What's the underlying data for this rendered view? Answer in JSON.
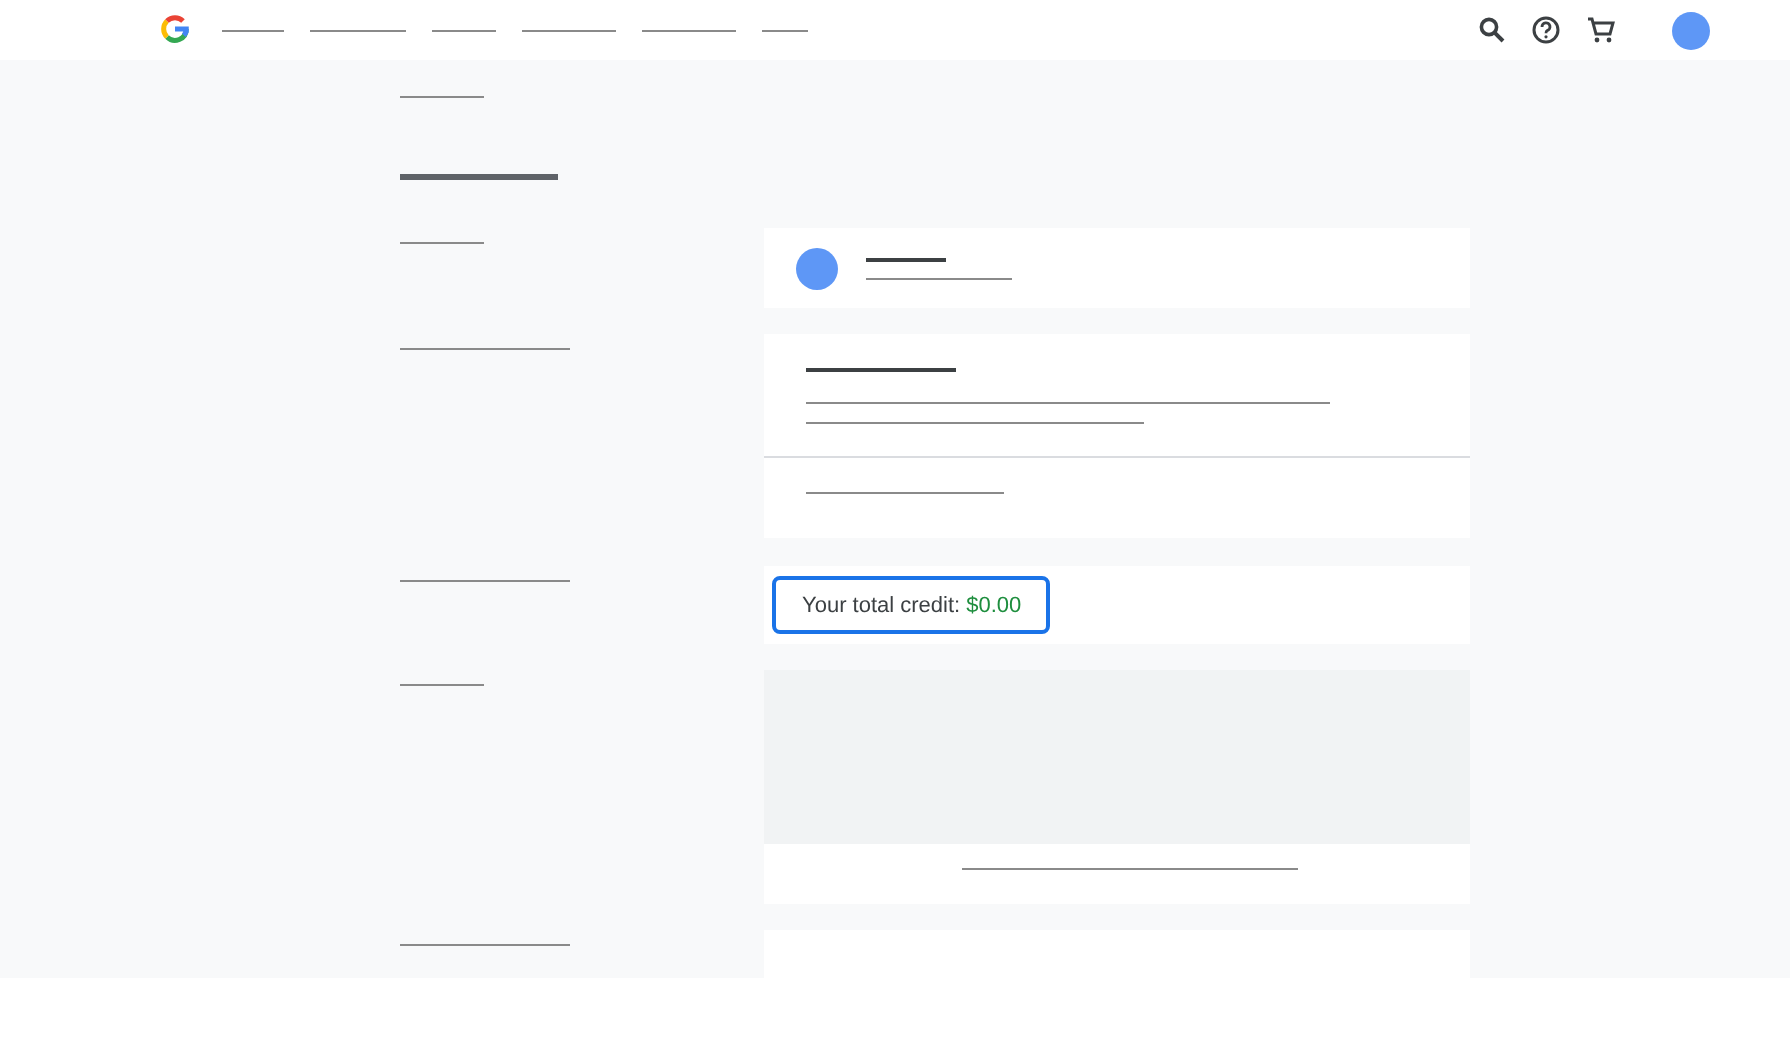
{
  "credit": {
    "label": "Your total credit:",
    "amount": "$0.00"
  }
}
